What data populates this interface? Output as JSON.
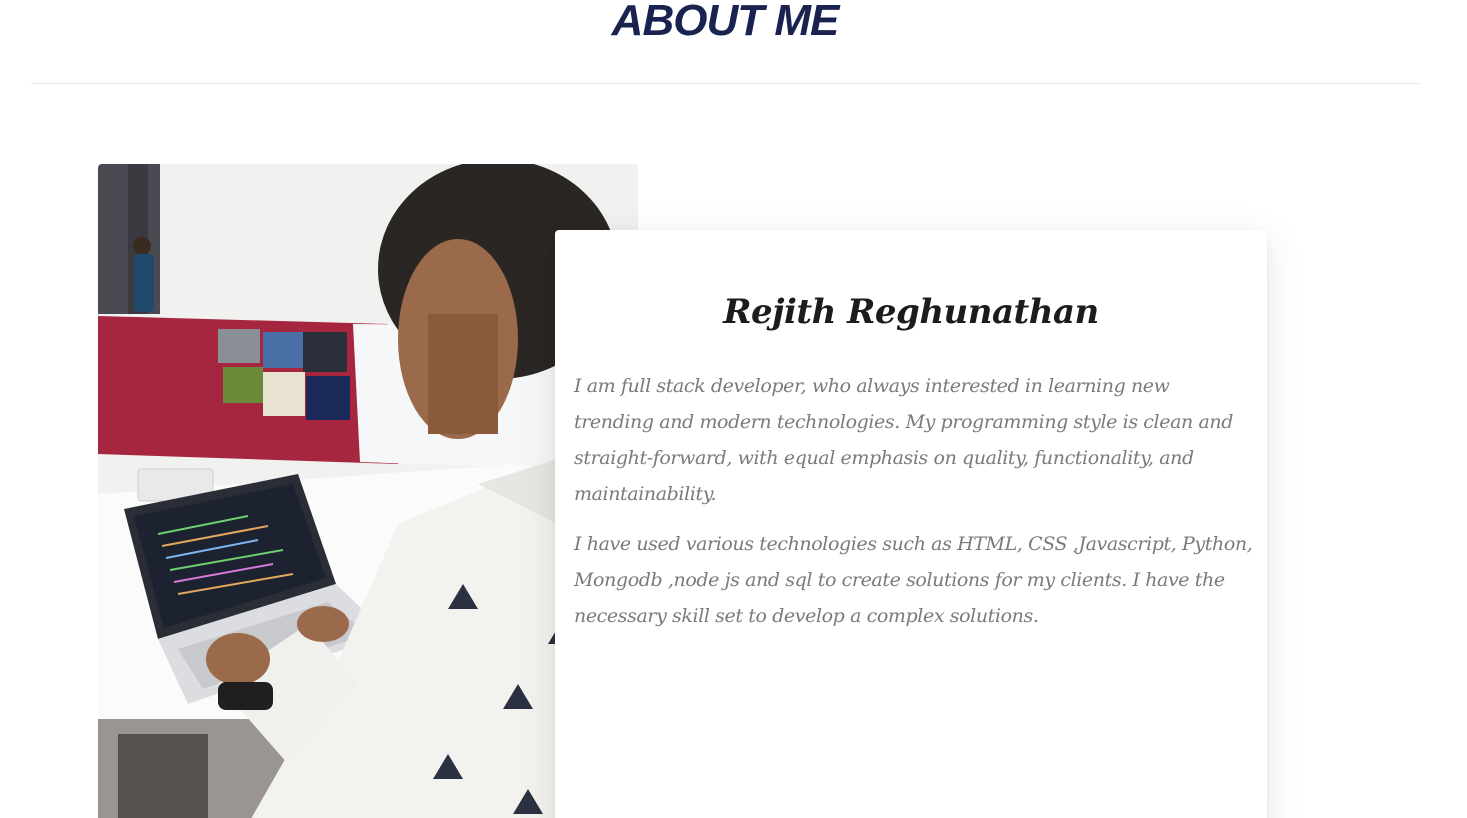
{
  "section": {
    "title": "ABOUT ME"
  },
  "profile": {
    "name": "Rejith Reghunathan",
    "bio_paragraphs": [
      "I am full stack developer, who always interested in learning new trending and modern technologies. My programming style is clean and straight-forward, with equal emphasis on quality, functionality, and maintainability.",
      "I have used various technologies such as HTML, CSS ,Javascript, Python, Mongodb ,node js and sql to create solutions for my clients. I have the necessary skill set to develop a complex solutions."
    ]
  },
  "photo": {
    "description_icon": "developer-photo"
  },
  "colors": {
    "title": "#1a2350",
    "name": "#1c1c1c",
    "body_text": "#7a7a7a",
    "divider": "#e3e3e3"
  }
}
